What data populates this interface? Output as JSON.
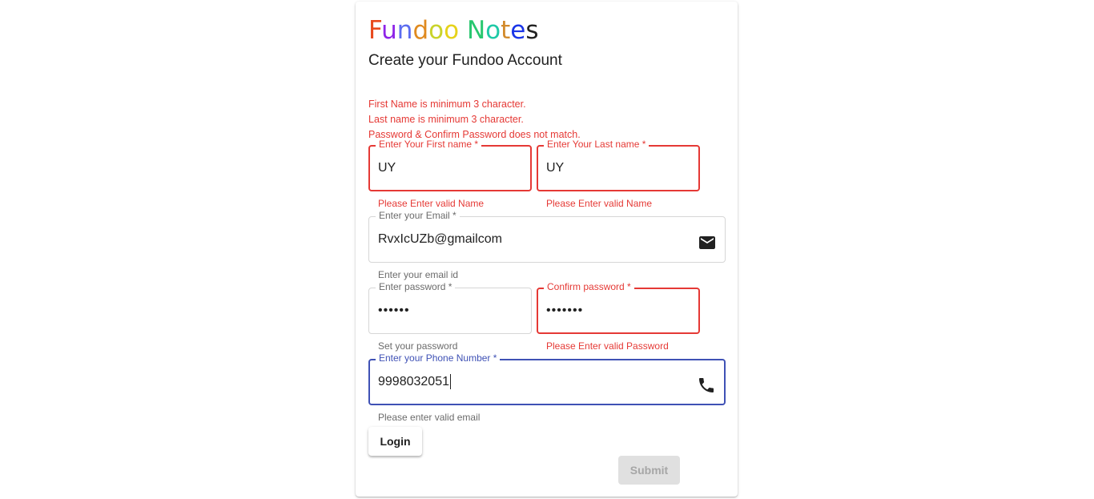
{
  "app": {
    "logo_letters": [
      {
        "char": "F",
        "color": "#e8491d"
      },
      {
        "char": "u",
        "color": "#8e24e8"
      },
      {
        "char": "n",
        "color": "#5b6cf0"
      },
      {
        "char": "d",
        "color": "#e08a1f"
      },
      {
        "char": "o",
        "color": "#c9d32a"
      },
      {
        "char": "o",
        "color": "#e6d21a"
      },
      {
        "char": " ",
        "color": "#ffffff"
      },
      {
        "char": "N",
        "color": "#28c76f"
      },
      {
        "char": "o",
        "color": "#1ec9a6"
      },
      {
        "char": "t",
        "color": "#d28a2c"
      },
      {
        "char": "e",
        "color": "#1a35e8"
      },
      {
        "char": "s",
        "color": "#222222"
      }
    ],
    "subtitle": "Create your Fundoo Account"
  },
  "errors": [
    "First Name is minimum 3 character.",
    "Last name is minimum 3 character.",
    "Password & Confirm Password does not match."
  ],
  "form": {
    "first_name": {
      "label": "Enter Your First name *",
      "value": "UY",
      "helper": "Please Enter valid Name"
    },
    "last_name": {
      "label": "Enter Your Last name *",
      "value": "UY",
      "helper": "Please Enter valid Name"
    },
    "email": {
      "label": "Enter your Email *",
      "value": "RvxIcUZb@gmailcom",
      "helper": "Enter your email id",
      "icon": "mail-icon"
    },
    "password": {
      "label": "Enter password *",
      "value": "••••••",
      "helper": "Set your password"
    },
    "confirm_password": {
      "label": "Confirm password *",
      "value": "•••••••",
      "helper": "Please Enter valid Password"
    },
    "phone": {
      "label": "Enter your Phone Number *",
      "value": "9998032051",
      "helper": "Please enter valid email",
      "icon": "phone-icon"
    }
  },
  "buttons": {
    "login": "Login",
    "submit": "Submit"
  },
  "colors": {
    "error": "#e53935",
    "focus": "#3f51b5"
  }
}
